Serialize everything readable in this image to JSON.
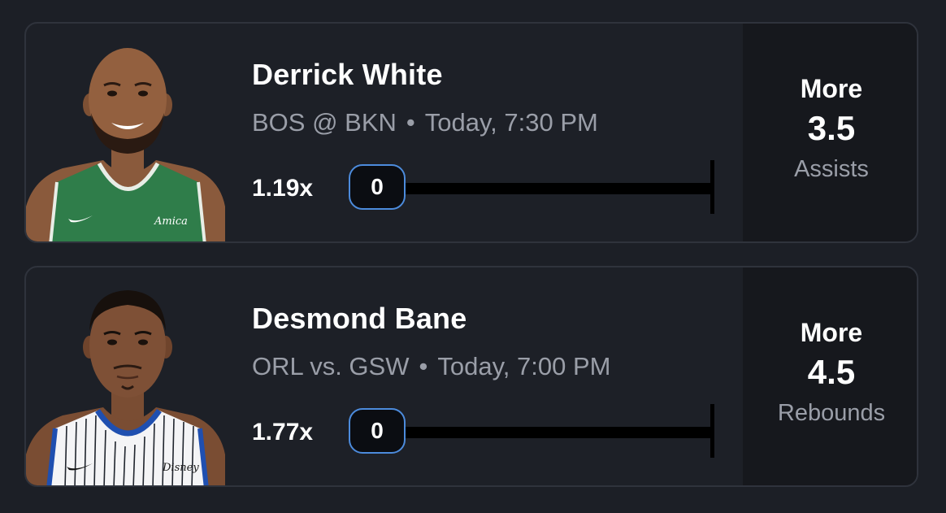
{
  "picks": [
    {
      "player_name": "Derrick White",
      "matchup": "BOS @ BKN",
      "separator": "•",
      "game_time": "Today, 7:30 PM",
      "multiplier": "1.19x",
      "progress_value": "0",
      "pick_direction": "More",
      "line": "3.5",
      "stat_type": "Assists",
      "jersey_color": "#2f7d4a",
      "jersey_text": "Amica"
    },
    {
      "player_name": "Desmond Bane",
      "matchup": "ORL vs. GSW",
      "separator": "•",
      "game_time": "Today, 7:00 PM",
      "multiplier": "1.77x",
      "progress_value": "0",
      "pick_direction": "More",
      "line": "4.5",
      "stat_type": "Rebounds",
      "jersey_color": "#f4f4f6",
      "jersey_text": "Disney"
    }
  ],
  "colors": {
    "background": "#1c1f26",
    "card_border": "#2f333c",
    "pill_border": "#4c8bdc",
    "secondary_text": "#9a9ea8"
  }
}
